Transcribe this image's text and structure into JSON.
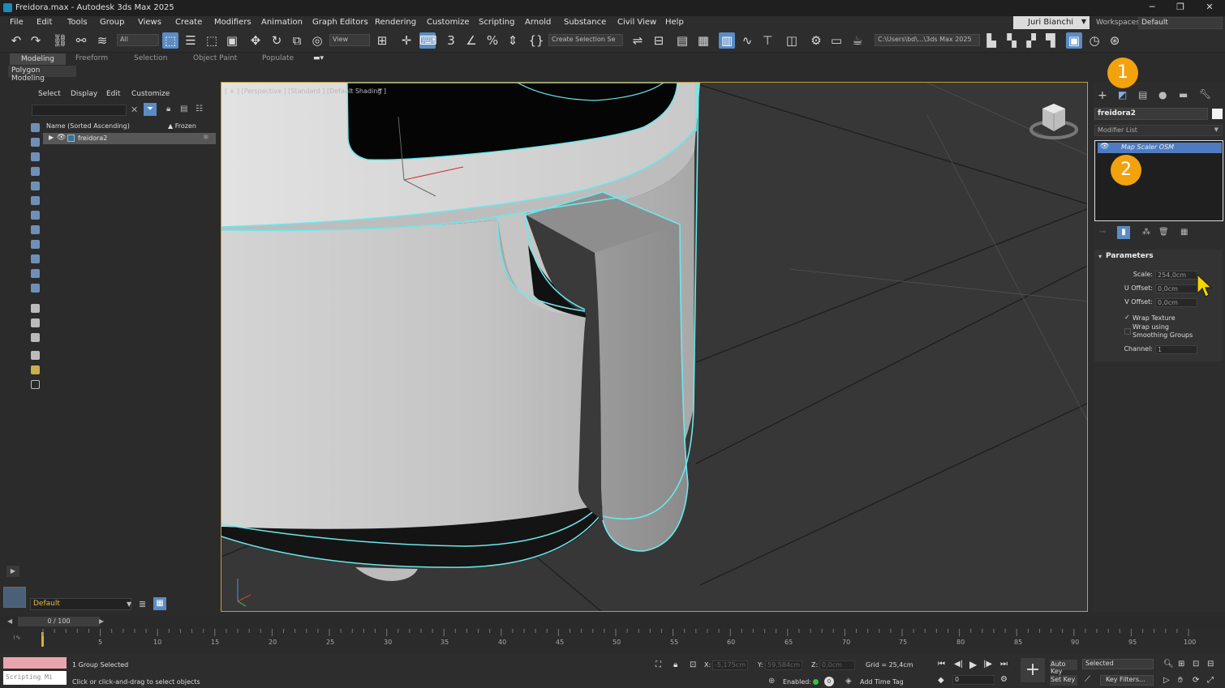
{
  "window": {
    "title": "Freidora.max - Autodesk 3ds Max 2025",
    "min": "─",
    "max": "❐",
    "close": "✕"
  },
  "menu": [
    "File",
    "Edit",
    "Tools",
    "Group",
    "Views",
    "Create",
    "Modifiers",
    "Animation",
    "Graph Editors",
    "Rendering",
    "Customize",
    "Scripting",
    "Arnold",
    "Substance",
    "Civil View",
    "Help"
  ],
  "user": {
    "name": "Juri Bianchi"
  },
  "workspaces": {
    "label": "Workspaces:",
    "value": "Default"
  },
  "toolbar": {
    "filter": "All",
    "ref_coord": "View",
    "selection_set": "Create Selection Se",
    "project_path": "C:\\Users\\bd\\...\\3ds Max 2025"
  },
  "ribbon": {
    "tabs": [
      "Modeling",
      "Freeform",
      "Selection",
      "Object Paint",
      "Populate"
    ],
    "sub": "Polygon Modeling"
  },
  "scene_explorer": {
    "menus": [
      "Select",
      "Display",
      "Edit",
      "Customize"
    ],
    "col_name": "Name (Sorted Ascending)",
    "col_frozen": "▲ Frozen",
    "row": "freidora2",
    "layer": "Default"
  },
  "viewport": {
    "label": "[ + ] [Perspective ] [Standard ] [Default Shading ]"
  },
  "command_panel": {
    "object_name": "freidora2",
    "modifier_list": "Modifier List",
    "stack_item": "Map Scaler OSM",
    "badge1": "1",
    "badge2": "2",
    "rollout": "Parameters",
    "params": {
      "scale_label": "Scale:",
      "scale": "254,0cm",
      "uoff_label": "U Offset:",
      "uoff": "0,0cm",
      "voff_label": "V Offset:",
      "voff": "0,0cm",
      "wrap_texture": "Wrap Texture",
      "wrap_smooth_1": "Wrap using",
      "wrap_smooth_2": "Smoothing Groups",
      "channel_label": "Channel:",
      "channel": "1"
    }
  },
  "timeline": {
    "frame": "0 / 100",
    "ticks": [
      "5",
      "10",
      "15",
      "20",
      "25",
      "30",
      "35",
      "40",
      "45",
      "50",
      "55",
      "60",
      "65",
      "70",
      "75",
      "80",
      "85",
      "90",
      "95",
      "100"
    ]
  },
  "status": {
    "script": "Scripting Mi",
    "selected": "1 Group Selected",
    "hint": "Click or click-and-drag to select objects",
    "x_label": "X:",
    "x": "-5,175cm",
    "y_label": "Y:",
    "y": "59,584cm",
    "z_label": "Z:",
    "z": "0,0cm",
    "grid": "Grid = 25,4cm",
    "enabled": "Enabled:",
    "time_tag": "Add Time Tag",
    "auto_key": "Auto Key",
    "set_key": "Set Key",
    "key_mode": "Selected",
    "key_filters": "Key Filters...",
    "frame_field": "0"
  }
}
